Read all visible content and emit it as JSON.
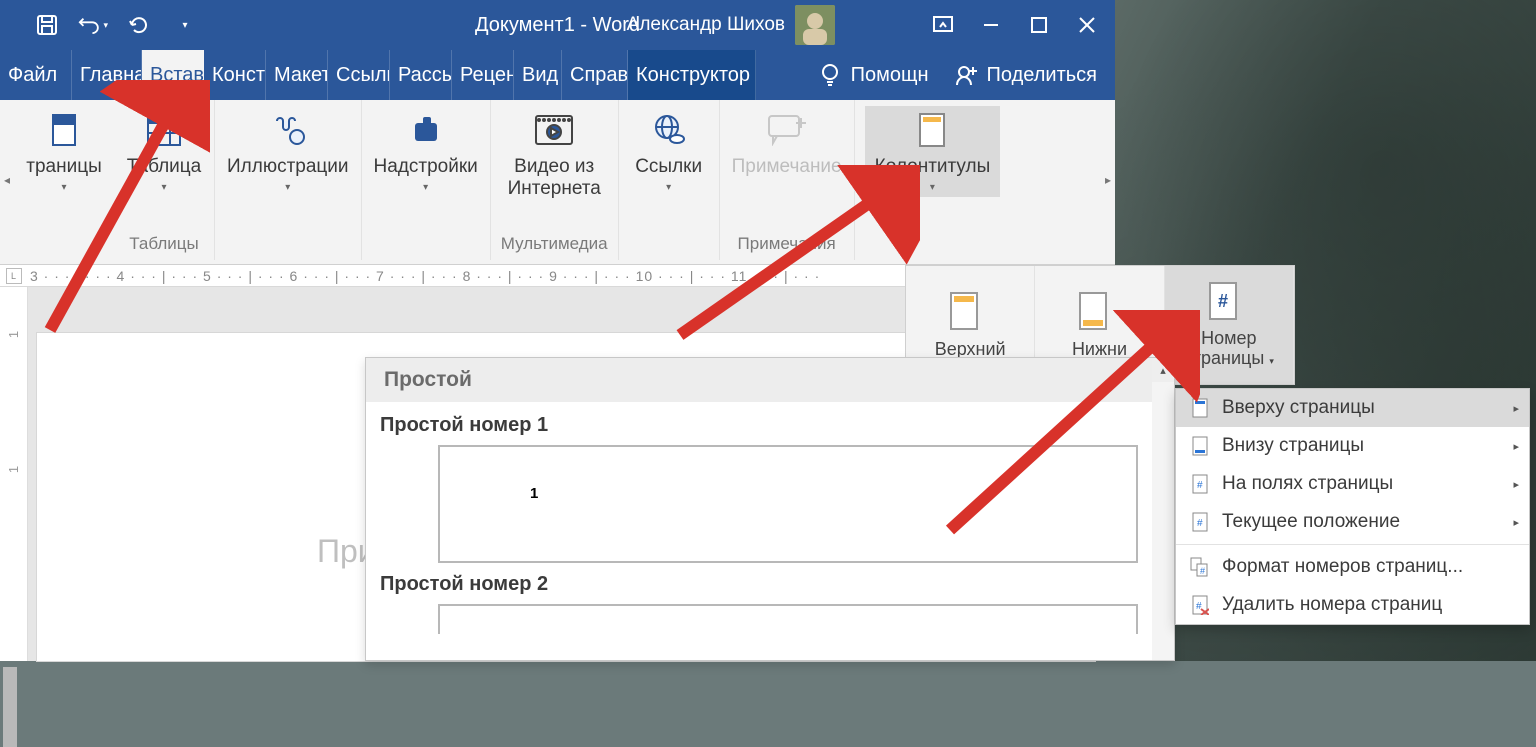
{
  "title": "Документ1  -  Word",
  "user": "Александр Шихов",
  "tabs": {
    "file": "Файл",
    "home": "Главна",
    "insert": "Вставк",
    "design": "Констр",
    "layout": "Макет",
    "references": "Ссылк",
    "mailings": "Рассы",
    "review": "Рецен",
    "view": "Вид",
    "help": "Справк",
    "designer": "Конструктор"
  },
  "help_label": "Помощн",
  "share_label": "Поделиться",
  "ribbon": {
    "pages": "траницы",
    "table": "Таблица",
    "tables_group": "Таблицы",
    "illustrations": "Иллюстрации",
    "addins": "Надстройки",
    "video": "Видео из",
    "video2": "Интернета",
    "multimedia_group": "Мультимедиа",
    "links": "Ссылки",
    "comment": "Примечание",
    "comments_group": "Примечания",
    "headerfooter": "Колонтитулы"
  },
  "ruler": "3 · · · | · · · 4 · · · | · · · 5 · · · | · · · 6 · · · | · · · 7 · · · | · · · 8 · · · | · · · 9 · · · | · · · 10 · · · | · · · 11 · · · | · · · ",
  "hf": {
    "top": "Верхний",
    "bottom": "Нижни",
    "number": "Номер",
    "number2": "страницы"
  },
  "gallery": {
    "title": "Простой",
    "item1": "Простой номер 1",
    "item1num": "1",
    "item2": "Простой номер 2"
  },
  "submenu": {
    "top": "Вверху страницы",
    "bottom": "Внизу страницы",
    "margins": "На полях страницы",
    "current": "Текущее положение",
    "format": "Формат номеров страниц...",
    "remove": "Удалить номера страниц"
  },
  "page_text": "При"
}
